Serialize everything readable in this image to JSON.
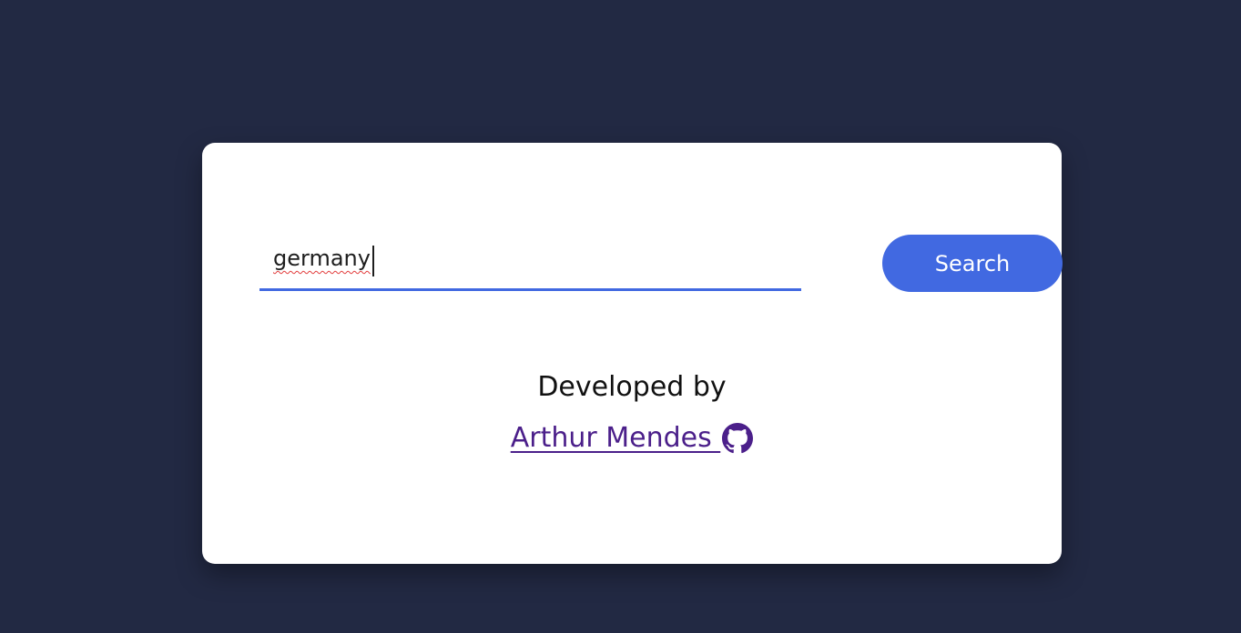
{
  "search": {
    "value": "germany",
    "button_label": "Search"
  },
  "credits": {
    "label": "Developed by",
    "author_name": "Arthur Mendes ",
    "icon": "github-icon"
  },
  "colors": {
    "background": "#222943",
    "card": "#ffffff",
    "accent": "#4169e1",
    "link": "#4b1f8a"
  }
}
